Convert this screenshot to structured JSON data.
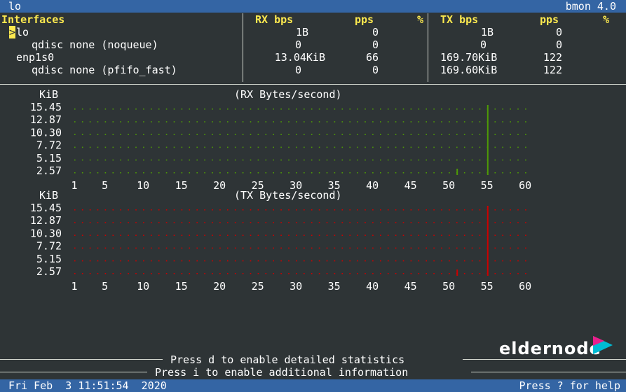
{
  "topbar": {
    "left": "lo",
    "right": "bmon 4.0"
  },
  "table": {
    "headers": {
      "interfaces": "Interfaces",
      "rx_bps": "RX bps",
      "rx_pps": "pps",
      "rx_pct": "%",
      "tx_bps": "TX bps",
      "tx_pps": "pps",
      "tx_pct": "%"
    },
    "select_marker": ">",
    "rows": [
      {
        "name": "lo",
        "rx_bps": "1B",
        "rx_pps": "0",
        "tx_bps": "1B",
        "tx_pps": "0"
      },
      {
        "name": "qdisc none (noqueue)",
        "rx_bps": "0",
        "rx_pps": "0",
        "tx_bps": "0",
        "tx_pps": "0"
      },
      {
        "name": "enp1s0",
        "rx_bps": "13.04KiB",
        "rx_pps": "66",
        "tx_bps": "169.70KiB",
        "tx_pps": "122"
      },
      {
        "name": "qdisc none (pfifo_fast)",
        "rx_bps": "0",
        "rx_pps": "0",
        "tx_bps": "169.60KiB",
        "tx_pps": "122"
      }
    ]
  },
  "graphs": [
    {
      "unit": "KiB",
      "title": "(RX Bytes/second)",
      "color": "#4e9a06",
      "yticks": [
        "15.45",
        "12.87",
        "10.30",
        "7.72",
        "5.15",
        "2.57"
      ],
      "xticks": [
        "1",
        "5",
        "10",
        "15",
        "20",
        "25",
        "30",
        "35",
        "40",
        "45",
        "50",
        "55",
        "60"
      ],
      "spikes": [
        {
          "x": 51,
          "top_row": 5
        },
        {
          "x": 55,
          "top_row": 0
        }
      ]
    },
    {
      "unit": "KiB",
      "title": "(TX Bytes/second)",
      "color": "#cc0000",
      "yticks": [
        "15.45",
        "12.87",
        "10.30",
        "7.72",
        "5.15",
        "2.57"
      ],
      "xticks": [
        "1",
        "5",
        "10",
        "15",
        "20",
        "25",
        "30",
        "35",
        "40",
        "45",
        "50",
        "55",
        "60"
      ],
      "spikes": [
        {
          "x": 51,
          "top_row": 5
        },
        {
          "x": 55,
          "top_row": 0
        }
      ]
    }
  ],
  "footer": {
    "hint1": "Press d to enable detailed statistics",
    "hint2": "Press i to enable additional information"
  },
  "statusbar": {
    "datetime": "Fri Feb  3 11:51:54  2020",
    "help": "Press ? for help"
  },
  "watermark": {
    "text": "eldernode",
    "accent": "#e91e8c",
    "accent2": "#00bcd4"
  }
}
